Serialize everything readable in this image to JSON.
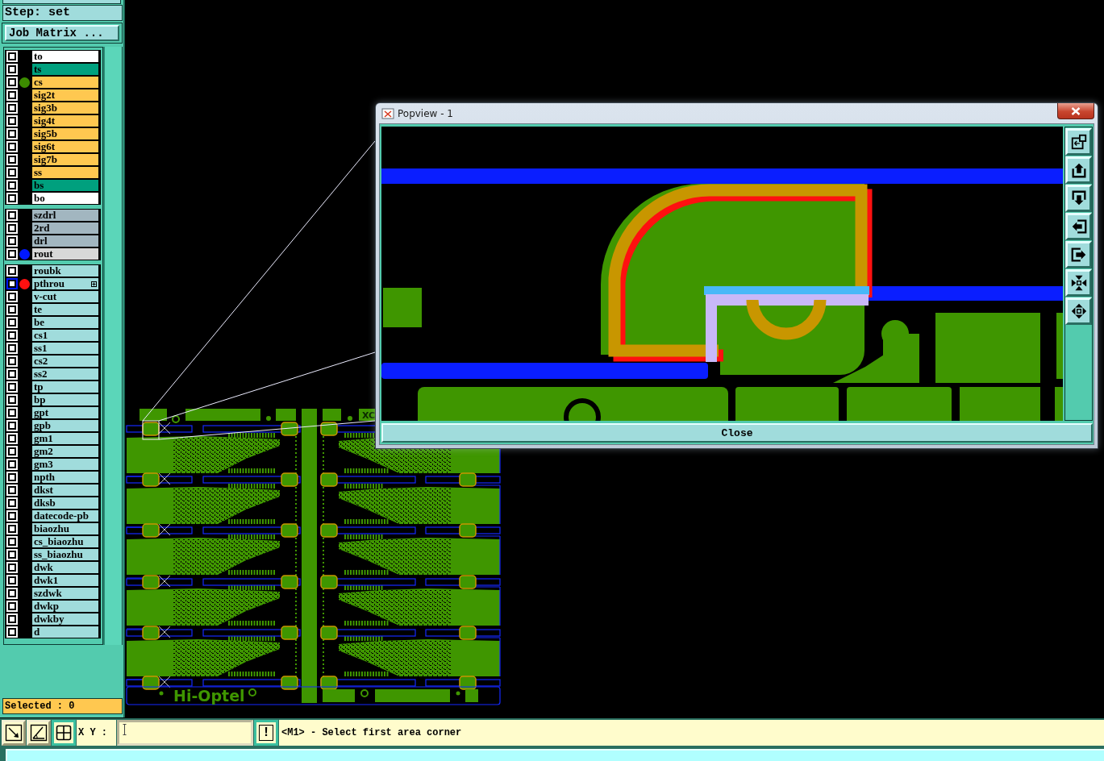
{
  "panel": {
    "step_label": "Step: set",
    "job_matrix_button": "Job Matrix ...",
    "selected_count": "Selected : 0"
  },
  "layer_groups": [
    {
      "layers": [
        {
          "name": "to",
          "kind": "silk_screen",
          "selected": false,
          "tagged": false
        },
        {
          "name": "ts",
          "kind": "solder_mask",
          "selected": false,
          "tagged": false
        },
        {
          "name": "cs",
          "kind": "signal",
          "selected": false,
          "tagged": false,
          "color": "#3c8c00"
        },
        {
          "name": "sig2t",
          "kind": "signal",
          "selected": false,
          "tagged": false
        },
        {
          "name": "sig3b",
          "kind": "signal",
          "selected": false,
          "tagged": false
        },
        {
          "name": "sig4t",
          "kind": "signal",
          "selected": false,
          "tagged": false
        },
        {
          "name": "sig5b",
          "kind": "signal",
          "selected": false,
          "tagged": false
        },
        {
          "name": "sig6t",
          "kind": "signal",
          "selected": false,
          "tagged": false
        },
        {
          "name": "sig7b",
          "kind": "signal",
          "selected": false,
          "tagged": false
        },
        {
          "name": "ss",
          "kind": "signal",
          "selected": false,
          "tagged": false
        },
        {
          "name": "bs",
          "kind": "solder_mask",
          "selected": false,
          "tagged": false
        },
        {
          "name": "bo",
          "kind": "silk_screen",
          "selected": false,
          "tagged": false
        }
      ]
    },
    {
      "layers": [
        {
          "name": "szdrl",
          "kind": "drill",
          "selected": false,
          "tagged": false
        },
        {
          "name": "2rd",
          "kind": "drill",
          "selected": false,
          "tagged": false
        },
        {
          "name": "drl",
          "kind": "drill",
          "selected": false,
          "tagged": false
        },
        {
          "name": "rout",
          "kind": "rout",
          "selected": false,
          "tagged": false,
          "color": "#0018ff"
        }
      ]
    },
    {
      "layers": [
        {
          "name": "roubk",
          "kind": "document",
          "selected": false,
          "tagged": false
        },
        {
          "name": "pthrou",
          "kind": "document",
          "selected": true,
          "tagged": true,
          "color": "#ff1010"
        },
        {
          "name": "v-cut",
          "kind": "document",
          "selected": false,
          "tagged": false
        },
        {
          "name": "te",
          "kind": "document",
          "selected": false,
          "tagged": false
        },
        {
          "name": "be",
          "kind": "document",
          "selected": false,
          "tagged": false
        },
        {
          "name": "cs1",
          "kind": "document",
          "selected": false,
          "tagged": false
        },
        {
          "name": "ss1",
          "kind": "document",
          "selected": false,
          "tagged": false
        },
        {
          "name": "cs2",
          "kind": "document",
          "selected": false,
          "tagged": false
        },
        {
          "name": "ss2",
          "kind": "document",
          "selected": false,
          "tagged": false
        },
        {
          "name": "tp",
          "kind": "document",
          "selected": false,
          "tagged": false
        },
        {
          "name": "bp",
          "kind": "document",
          "selected": false,
          "tagged": false
        },
        {
          "name": "gpt",
          "kind": "document",
          "selected": false,
          "tagged": false
        },
        {
          "name": "gpb",
          "kind": "document",
          "selected": false,
          "tagged": false
        },
        {
          "name": "gm1",
          "kind": "document",
          "selected": false,
          "tagged": false
        },
        {
          "name": "gm2",
          "kind": "document",
          "selected": false,
          "tagged": false
        },
        {
          "name": "gm3",
          "kind": "document",
          "selected": false,
          "tagged": false
        },
        {
          "name": "npth",
          "kind": "document",
          "selected": false,
          "tagged": false
        },
        {
          "name": "dkst",
          "kind": "document",
          "selected": false,
          "tagged": false
        },
        {
          "name": "dksb",
          "kind": "document",
          "selected": false,
          "tagged": false
        },
        {
          "name": "datecode-pb",
          "kind": "document",
          "selected": false,
          "tagged": false
        },
        {
          "name": "biaozhu",
          "kind": "document",
          "selected": false,
          "tagged": false
        },
        {
          "name": "cs_biaozhu",
          "kind": "document",
          "selected": false,
          "tagged": false
        },
        {
          "name": "ss_biaozhu",
          "kind": "document",
          "selected": false,
          "tagged": false
        },
        {
          "name": "dwk",
          "kind": "document",
          "selected": false,
          "tagged": false
        },
        {
          "name": "dwk1",
          "kind": "document",
          "selected": false,
          "tagged": false
        },
        {
          "name": "szdwk",
          "kind": "document",
          "selected": false,
          "tagged": false
        },
        {
          "name": "dwkp",
          "kind": "document",
          "selected": false,
          "tagged": false
        },
        {
          "name": "dwkby",
          "kind": "document",
          "selected": false,
          "tagged": false
        },
        {
          "name": "d",
          "kind": "document",
          "selected": false,
          "tagged": false
        }
      ]
    }
  ],
  "board": {
    "top_label": "XC",
    "brand_label": "Hi-Optel"
  },
  "popview": {
    "title": "Popview - 1",
    "close_button": "Close"
  },
  "toolbar": {
    "tools": [
      {
        "kind": "zoom_area",
        "selected": false
      },
      {
        "kind": "measure",
        "selected": false
      },
      {
        "kind": "grid",
        "selected": true
      }
    ],
    "xy_label": "X Y :",
    "info_button": "!",
    "prompt": "<M1> - Select first area corner"
  }
}
